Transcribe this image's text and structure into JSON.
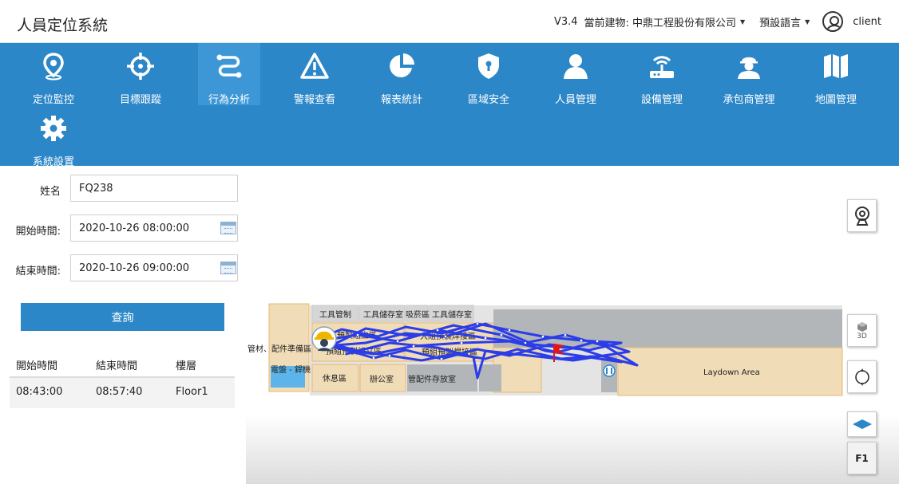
{
  "header": {
    "title": "人員定位系統",
    "version": "V3.4",
    "building_label": "當前建物:",
    "building_value": "中鼎工程股份有限公司",
    "language": "預設語言",
    "user": "client"
  },
  "nav": {
    "items": [
      {
        "label": "定位監控",
        "icon": "location-pin-icon"
      },
      {
        "label": "目標跟蹤",
        "icon": "crosshair-icon"
      },
      {
        "label": "行為分析",
        "icon": "route-icon",
        "active": true
      },
      {
        "label": "警報查看",
        "icon": "warning-icon"
      },
      {
        "label": "報表統計",
        "icon": "pie-chart-icon"
      },
      {
        "label": "區域安全",
        "icon": "shield-icon"
      },
      {
        "label": "人員管理",
        "icon": "person-icon"
      },
      {
        "label": "設備管理",
        "icon": "router-icon"
      },
      {
        "label": "承包商管理",
        "icon": "worker-icon"
      },
      {
        "label": "地圖管理",
        "icon": "map-icon"
      },
      {
        "label": "系統設置",
        "icon": "gear-icon"
      }
    ]
  },
  "form": {
    "name_label": "姓名",
    "name_value": "FQ238",
    "start_label": "開始時間:",
    "start_value": "2020-10-26 08:00:00",
    "end_label": "結束時間:",
    "end_value": "2020-10-26 09:00:00",
    "query_label": "查詢"
  },
  "table": {
    "headers": [
      "開始時間",
      "結束時間",
      "樓層"
    ],
    "rows": [
      [
        "08:43:00",
        "08:57:40",
        "Floor1"
      ]
    ]
  },
  "map": {
    "zones": {
      "tool_control": "工具管制",
      "tool_storage": "工具儲存室",
      "smoking": "吸菸區",
      "tool_storage2": "工具儲存室",
      "prefab_a": "預製組立區",
      "pipe_prep": "管材、配件準備區",
      "prefab_b": "預組預製組立區",
      "welding_a": "大組預製焊接區",
      "welding_b": "預組預製焊接區",
      "panel": "電盤 - 銲機",
      "rest": "休息區",
      "office": "辦公室",
      "fitting_storage": "管配件存放室",
      "laydown": "Laydown Area"
    },
    "tools": {
      "three_d": "3D",
      "floor": "F1"
    },
    "colors": {
      "path": "#2b3de8",
      "zone_tan": "#f1dcb8",
      "zone_grey": "#b3b6b8",
      "zone_blue": "#5cb4ea",
      "flag": "#e0161c"
    }
  }
}
